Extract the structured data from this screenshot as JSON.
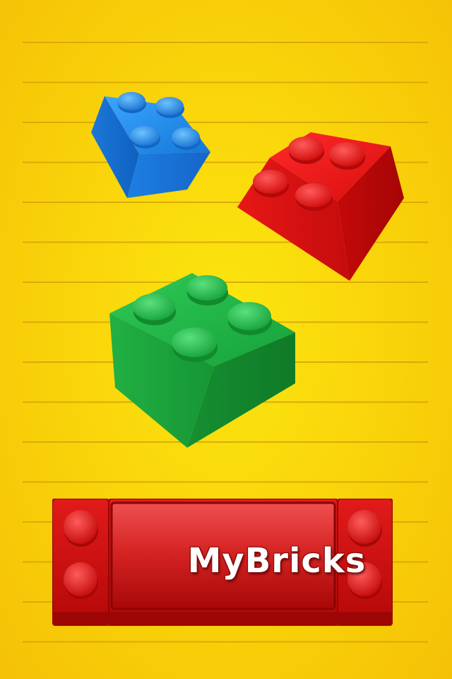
{
  "app": {
    "logo_text": "MyBricks"
  },
  "background": {
    "base_color": "#f9d20a",
    "line_color": "#d6a408"
  },
  "bricks": [
    {
      "name": "blue-brick",
      "color": "#1a7fe0"
    },
    {
      "name": "red-brick",
      "color": "#e01010"
    },
    {
      "name": "green-brick",
      "color": "#1ea33c"
    }
  ],
  "logo_plate": {
    "color": "#d11414"
  }
}
